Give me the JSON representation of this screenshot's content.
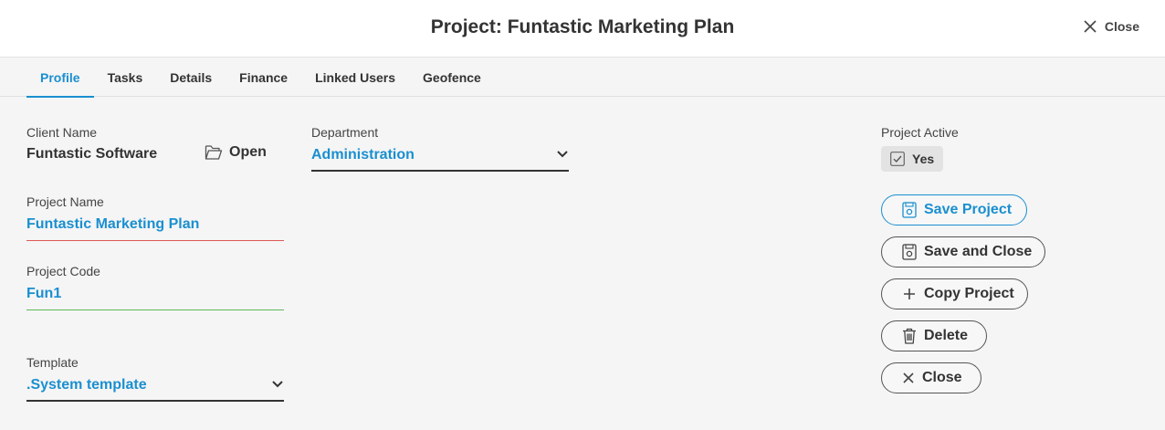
{
  "header": {
    "title": "Project: Funtastic Marketing Plan",
    "close_label": "Close"
  },
  "tabs": [
    {
      "label": "Profile",
      "active": true
    },
    {
      "label": "Tasks"
    },
    {
      "label": "Details"
    },
    {
      "label": "Finance"
    },
    {
      "label": "Linked Users"
    },
    {
      "label": "Geofence"
    }
  ],
  "form": {
    "client_name": {
      "label": "Client Name",
      "value": "Funtastic Software",
      "open_label": "Open"
    },
    "department": {
      "label": "Department",
      "value": "Administration"
    },
    "project_name": {
      "label": "Project Name",
      "value": "Funtastic Marketing Plan"
    },
    "project_code": {
      "label": "Project Code",
      "value": "Fun1"
    },
    "template": {
      "label": "Template",
      "value": ".System template"
    },
    "project_active": {
      "label": "Project Active",
      "value": "Yes",
      "checked": true
    }
  },
  "actions": {
    "save": "Save Project",
    "save_close": "Save and Close",
    "copy": "Copy Project",
    "delete": "Delete",
    "close": "Close"
  },
  "colors": {
    "accent": "#1a8fd0",
    "error_underline": "#e05a5a",
    "valid_underline": "#5cb85c"
  }
}
